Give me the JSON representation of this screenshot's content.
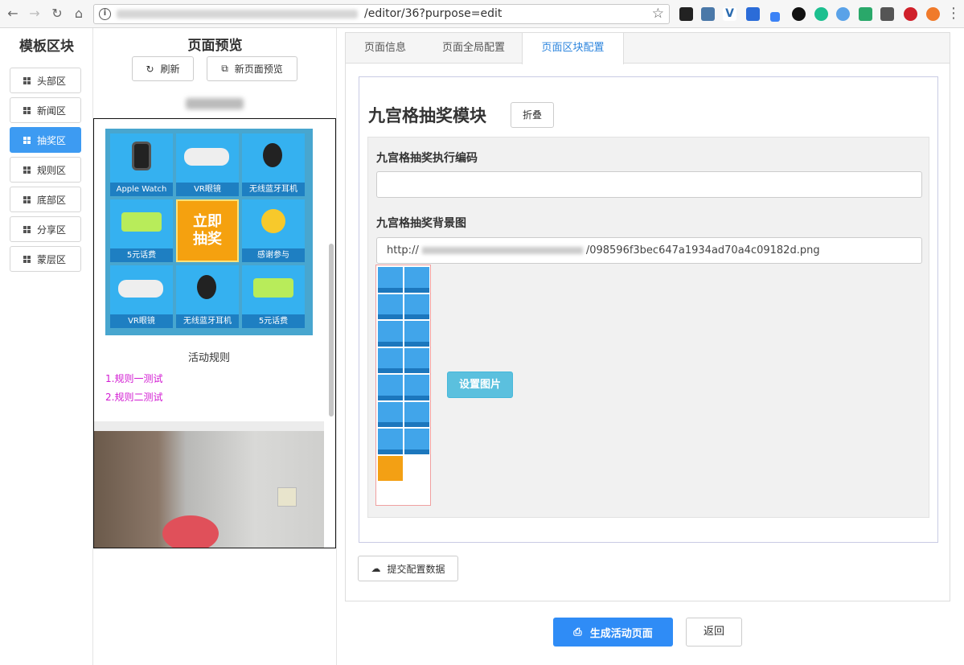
{
  "browser": {
    "url_visible": "/editor/36?purpose=edit",
    "url_full_tail": "/editor/36?purpose=edit"
  },
  "left_panel": {
    "title": "模板区块",
    "items": [
      {
        "label": "头部区",
        "active": false
      },
      {
        "label": "新闻区",
        "active": false
      },
      {
        "label": "抽奖区",
        "active": true
      },
      {
        "label": "规则区",
        "active": false
      },
      {
        "label": "底部区",
        "active": false
      },
      {
        "label": "分享区",
        "active": false
      },
      {
        "label": "蒙层区",
        "active": false
      }
    ]
  },
  "preview": {
    "title": "页面预览",
    "refresh_label": "刷新",
    "new_page_preview_label": "新页面预览",
    "lottery_cells": [
      "Apple Watch",
      "VR眼镜",
      "无线蓝牙耳机",
      "5元话费",
      "立即抽奖",
      "感谢参与",
      "VR眼镜",
      "无线蓝牙耳机",
      "5元话费"
    ],
    "center_text_1": "立即",
    "center_text_2": "抽奖",
    "rules_title": "活动规则",
    "rule_1": "1.规则一测试",
    "rule_2": "2.规则二测试"
  },
  "config": {
    "tabs": [
      {
        "label": "页面信息",
        "active": false
      },
      {
        "label": "页面全局配置",
        "active": false
      },
      {
        "label": "页面区块配置",
        "active": true
      }
    ],
    "module_title": "九宫格抽奖模块",
    "fold_label": "折叠",
    "code_label": "九宫格抽奖执行编码",
    "code_value": "",
    "bg_label": "九宫格抽奖背景图",
    "bg_url_prefix": "http://",
    "bg_url_suffix": "/098596f3bec647a1934ad70a4c09182d.png",
    "set_image_label": "设置图片",
    "submit_label": "提交配置数据"
  },
  "footer": {
    "generate_label": "生成活动页面",
    "back_label": "返回"
  },
  "colors": {
    "accent": "#3d9bf2",
    "tab_active": "#2e86de",
    "info_button": "#5bc0de",
    "rule_text": "#d21bd2"
  }
}
